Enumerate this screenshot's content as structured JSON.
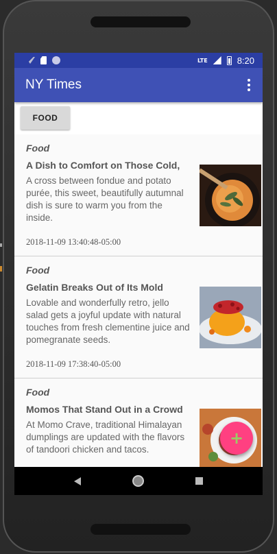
{
  "status_bar": {
    "time": "8:20",
    "lte": "LTE"
  },
  "app_bar": {
    "title": "NY Times"
  },
  "filter": {
    "chip_label": "FOOD"
  },
  "articles": [
    {
      "section": "Food",
      "headline": "A Dish to Comfort on Those Cold,",
      "abstract": "A cross between fondue and potato purée, this sweet, beautifully autumnal dish is sure to warm you from the inside.",
      "date": "2018-11-09 13:40:48-05:00",
      "image": "soup-dish-photo"
    },
    {
      "section": "Food",
      "headline": "Gelatin Breaks Out of Its Mold",
      "abstract": "Lovable and wonderfully retro, jello salad gets a joyful update with natural touches from fresh clementine juice and pomegranate seeds.",
      "date": "2018-11-09 17:38:40-05:00",
      "image": "jello-salad-photo"
    },
    {
      "section": "Food",
      "headline": "Momos That Stand Out in a Crowd",
      "abstract": "At Momo Crave, traditional Himalayan dumplings are updated with the flavors of tandoori chicken and tacos.",
      "date": "",
      "image": "momos-photo"
    }
  ],
  "fab": {
    "icon": "plus-icon",
    "glyph": "+"
  },
  "colors": {
    "primary": "#3f51b5",
    "primary_dark": "#2b3ea4",
    "accent": "#ff4081"
  }
}
